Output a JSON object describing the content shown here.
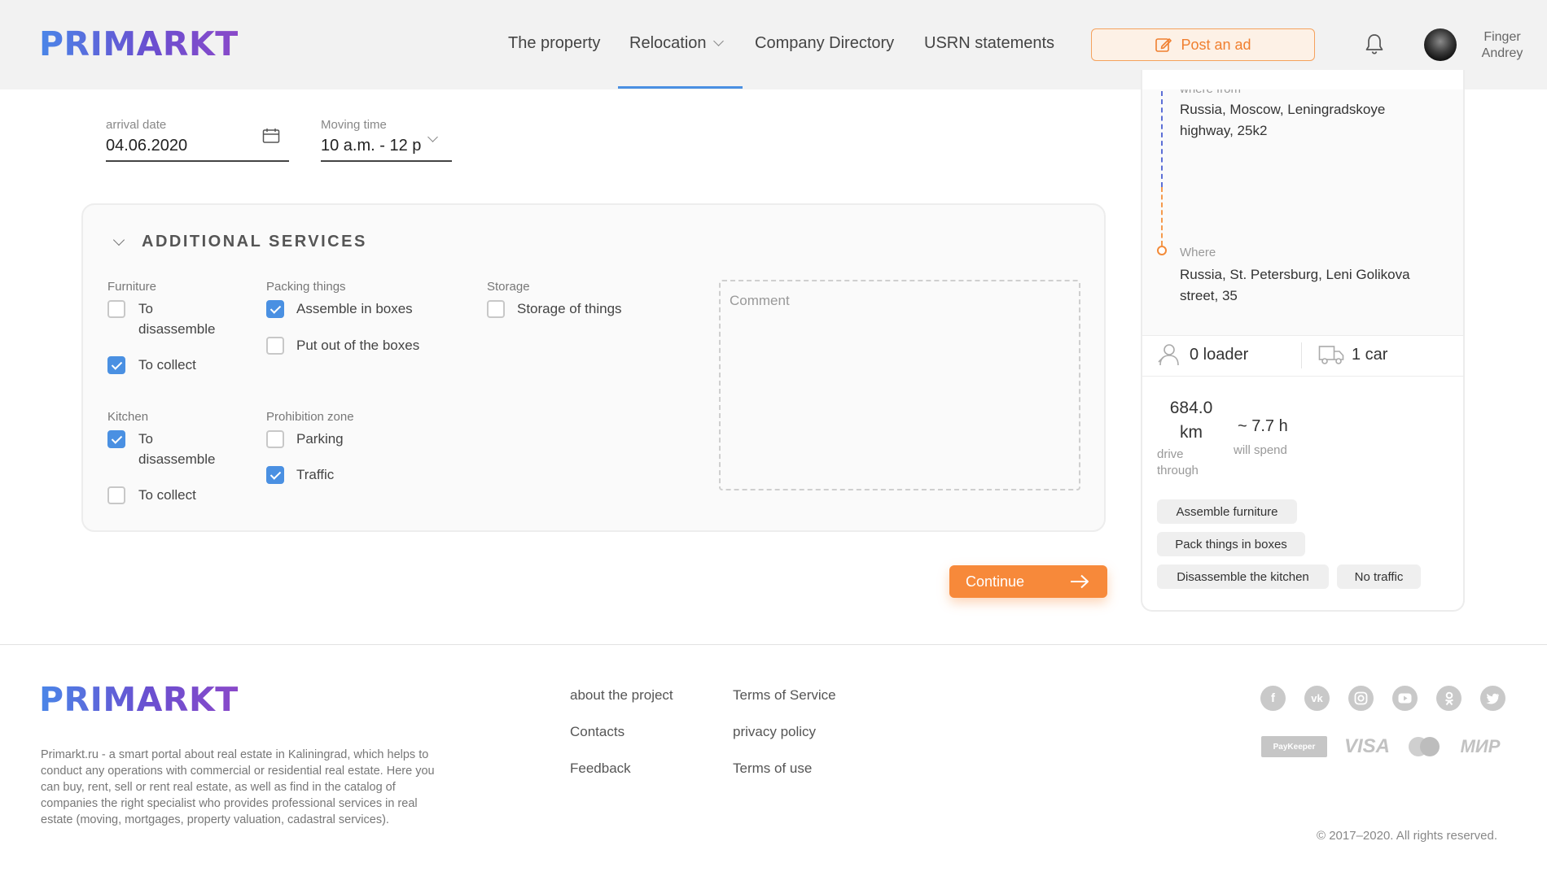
{
  "header": {
    "logo": "PRIMARKT",
    "nav": [
      {
        "label": "The property"
      },
      {
        "label": "Relocation"
      },
      {
        "label": "Company Directory"
      },
      {
        "label": "USRN statements"
      }
    ],
    "post_ad": "Post an ad",
    "user": {
      "first": "Finger",
      "last": "Andrey"
    }
  },
  "form": {
    "arrival": {
      "label": "arrival date",
      "value": "04.06.2020"
    },
    "moving_time": {
      "label": "Moving time",
      "value": "10 a.m. - 12 p"
    }
  },
  "services": {
    "title": "ADDITIONAL SERVICES",
    "furniture": {
      "label": "Furniture",
      "items": [
        {
          "label_line1": "To",
          "label_line2": "disassemble",
          "checked": false
        },
        {
          "label": "To collect",
          "checked": true
        }
      ]
    },
    "packing": {
      "label": "Packing things",
      "items": [
        {
          "label": "Assemble in boxes",
          "checked": true
        },
        {
          "label": "Put out of the boxes",
          "checked": false
        }
      ]
    },
    "storage": {
      "label": "Storage",
      "items": [
        {
          "label": "Storage of things",
          "checked": false
        }
      ]
    },
    "kitchen": {
      "label": "Kitchen",
      "items": [
        {
          "label_line1": "To",
          "label_line2": "disassemble",
          "checked": true
        },
        {
          "label": "To collect",
          "checked": false
        }
      ]
    },
    "prohibition": {
      "label": "Prohibition zone",
      "items": [
        {
          "label": "Parking",
          "checked": false
        },
        {
          "label": "Traffic",
          "checked": true
        }
      ]
    },
    "comment_placeholder": "Comment"
  },
  "continue_label": "Continue",
  "route": {
    "from_label": "where from",
    "from_line1": "Russia, Moscow, Leningradskoye",
    "from_line2": "highway, 25k2",
    "to_label": "Where",
    "to_line1": "Russia, St. Petersburg, Leni Golikova",
    "to_line2": "street, 35",
    "loaders": "0 loader",
    "cars": "1 car",
    "distance_value": "684.0",
    "distance_unit": "km",
    "distance_label1": "drive",
    "distance_label2": "through",
    "time_value": "~ 7.7 h",
    "time_label": "will spend",
    "tags": [
      "Assemble furniture",
      "Pack things in boxes",
      "Disassemble the kitchen",
      "No traffic"
    ]
  },
  "footer": {
    "logo": "PRIMARKT",
    "description": "Primarkt.ru - a smart portal about real estate in Kaliningrad, which helps to conduct any operations with commercial or residential real estate. Here you can buy, rent, sell or rent real estate, as well as find in the catalog of companies the right specialist who provides professional services in real estate (moving, mortgages, property valuation, cadastral services).",
    "links_col1": [
      "about the project",
      "Contacts",
      "Feedback"
    ],
    "links_col2": [
      "Terms of Service",
      "privacy policy",
      "Terms of use"
    ],
    "social_icons": [
      "facebook-icon",
      "vk-icon",
      "instagram-icon",
      "youtube-icon",
      "odnoklassniki-icon",
      "twitter-icon"
    ],
    "payments": [
      "PayKeeper",
      "VISA",
      "MasterCard",
      "МИР"
    ],
    "copyright": "© 2017–2020. All rights reserved."
  },
  "colors": {
    "accent_orange": "#f7893a",
    "accent_blue": "#4a90e2",
    "logo_start": "#4a86e8",
    "logo_end": "#8a49c9"
  }
}
